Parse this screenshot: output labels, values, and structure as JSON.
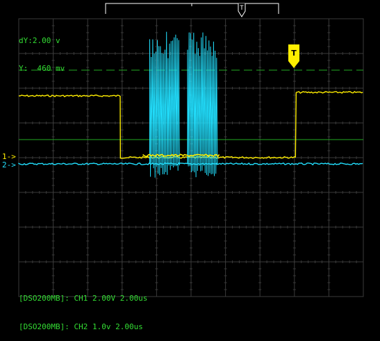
{
  "cursor": {
    "dy_readout": "dY:2.00 v",
    "y_readout": "Y:  460 mv"
  },
  "markers": {
    "ch1": "1->",
    "ch2": "2->",
    "trigger_label": "T",
    "trigger_pos_label": "T"
  },
  "status": {
    "ch1_line": "[DSO200MB]: CH1 2.00V 2.00us",
    "ch2_line": "[DSO200MB]: CH2 1.0v 2.00us"
  },
  "chart_data": {
    "type": "line",
    "title": "",
    "xlabel": "",
    "ylabel": "",
    "time_per_div_us": 2.0,
    "divisions_x": 10,
    "divisions_y": 8,
    "grid": true,
    "series": [
      {
        "name": "CH1",
        "color": "#ffee00",
        "volts_per_div": 2.0,
        "x": [
          0,
          5.9,
          5.9,
          16.1,
          16.1,
          20
        ],
        "y": [
          3.6,
          3.6,
          0.05,
          0.05,
          3.8,
          3.8
        ]
      },
      {
        "name": "CH2",
        "color": "#22e0ff",
        "volts_per_div": 1.0,
        "x": [
          0,
          7.6,
          9.3,
          9.8,
          11.5,
          20
        ],
        "y": [
          0,
          0,
          0,
          0,
          0,
          0
        ],
        "bursts": [
          {
            "start_us": 7.6,
            "end_us": 9.3
          },
          {
            "start_us": 9.8,
            "end_us": 11.5
          }
        ]
      }
    ],
    "cursor_level_v": 0.46,
    "trigger_level_v": 3.0
  },
  "colors": {
    "background": "#000000",
    "grid": "#3a3a3a",
    "text": "#33dd33",
    "ch1": "#ffee00",
    "ch2": "#22e0ff",
    "cursor": "#22aa22"
  }
}
